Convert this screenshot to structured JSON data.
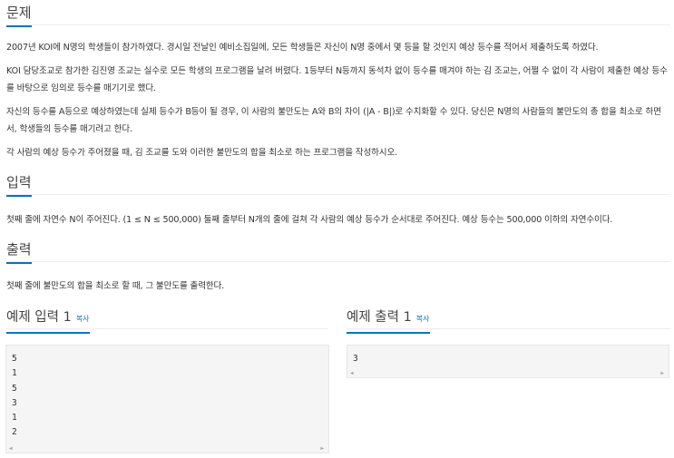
{
  "problem": {
    "title": "문제",
    "paragraphs": [
      "2007년 KOI에 N명의 학생들이 참가하였다. 경시일 전날인 예비소집일에, 모든 학생들은 자신이 N명 중에서 몇 등을 할 것인지 예상 등수를 적어서 제출하도록 하였다.",
      "KOI 담당조교로 참가한 김진영 조교는 실수로 모든 학생의 프로그램을 날려 버렸다. 1등부터 N등까지 동석차 없이 등수를 매겨야 하는 김 조교는, 어쩔 수 없이 각 사람이 제출한 예상 등수를 바탕으로 임의로 등수를 매기기로 했다.",
      "자신의 등수를 A등으로 예상하였는데 실제 등수가 B등이 될 경우, 이 사람의 불만도는 A와 B의 차이 (|A - B|)로 수치화할 수 있다. 당신은 N명의 사람들의 불만도의 총 합을 최소로 하면서, 학생들의 등수를 매기려고 한다.",
      "각 사람의 예상 등수가 주어졌을 때, 김 조교를 도와 이러한 불만도의 합을 최소로 하는 프로그램을 작성하시오."
    ]
  },
  "input": {
    "title": "입력",
    "text": "첫째 줄에 자연수 N이 주어진다. (1 ≤ N ≤ 500,000) 둘째 줄부터 N개의 줄에 걸쳐 각 사람의 예상 등수가 순서대로 주어진다. 예상 등수는 500,000 이하의 자연수이다."
  },
  "output": {
    "title": "출력",
    "text": "첫째 줄에 불만도의 합을 최소로 할 때, 그 불만도를 출력한다."
  },
  "sample_input": {
    "title": "예제 입력 1",
    "copy_label": "복사",
    "content": "5\n1\n5\n3\n1\n2"
  },
  "sample_output": {
    "title": "예제 출력 1",
    "copy_label": "복사",
    "content": "3"
  },
  "icons": {
    "scroll_left": "scroll-left-arrow-icon",
    "scroll_right": "scroll-right-arrow-icon"
  },
  "colors": {
    "accent": "#0076c0",
    "sample_background": "#f5f5f5",
    "text": "#333333"
  }
}
